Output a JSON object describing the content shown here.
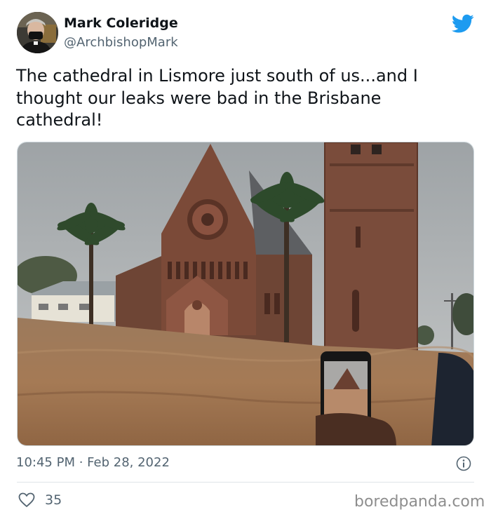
{
  "author": {
    "name": "Mark Coleridge",
    "handle": "@ArchbishopMark"
  },
  "tweet": {
    "lines": [
      "The cathedral in Lismore just south of us...and I",
      "thought our leaks were bad in the Brisbane",
      "cathedral!"
    ],
    "timestamp": "10:45 PM · Feb 28, 2022",
    "like_count": "35"
  },
  "icons": {
    "brand": "twitter-bird-icon",
    "info": "info-icon",
    "like": "heart-outline-icon"
  },
  "watermark": "boredpanda.com",
  "colors": {
    "twitter_blue": "#1d9bf0",
    "text_primary": "#0f1419",
    "text_secondary": "#536471",
    "divider": "#dfe4e8"
  }
}
